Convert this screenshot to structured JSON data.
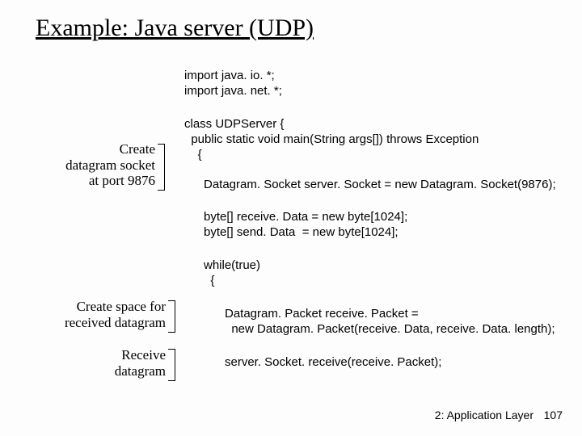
{
  "title": "Example: Java server (UDP)",
  "code": {
    "imports": "import java. io. *;\nimport java. net. *;",
    "class_open": "class UDPServer {\n  public static void main(String args[]) throws Exception\n    {",
    "socket": "Datagram. Socket server. Socket = new Datagram. Socket(9876);",
    "buffers": "byte[] receive. Data = new byte[1024];\nbyte[] send. Data  = new byte[1024];",
    "while": "while(true)\n  {",
    "packet": "Datagram. Packet receive. Packet =\n  new Datagram. Packet(receive. Data, receive. Data. length);",
    "receive": "server. Socket. receive(receive. Packet);"
  },
  "annotations": {
    "a1": "Create\ndatagram socket\nat port 9876",
    "a2": "Create space for\nreceived datagram",
    "a3": "Receive\ndatagram"
  },
  "footer": {
    "label": "2: Application Layer",
    "page": "107"
  }
}
